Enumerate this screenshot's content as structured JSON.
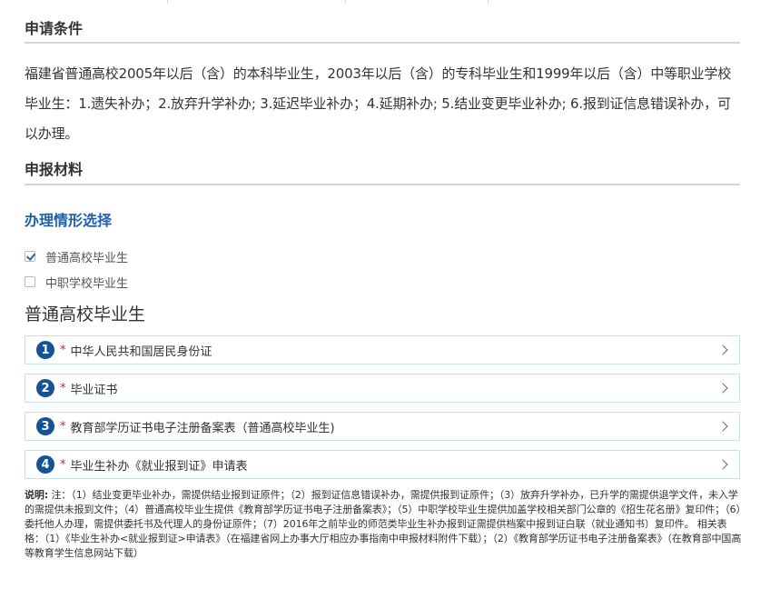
{
  "sections": {
    "conditions_title": "申请条件",
    "conditions_text": "福建省普通高校2005年以后（含）的本科毕业生，2003年以后（含）的专科毕业生和1999年以后（含）中等职业学校毕业生：1.遗失补办；2.放弃升学补办; 3.延迟毕业补办；4.延期补办; 5.结业变更毕业补办; 6.报到证信息错误补办，可以办理。",
    "materials_title": "申报材料"
  },
  "situation": {
    "title": "办理情形选择",
    "options": [
      {
        "label": "普通高校毕业生",
        "checked": true
      },
      {
        "label": "中职学校毕业生",
        "checked": false
      }
    ]
  },
  "materials": {
    "heading": "普通高校毕业生",
    "items": [
      {
        "num": "1",
        "star": "*",
        "label": "中华人民共和国居民身份证"
      },
      {
        "num": "2",
        "star": "*",
        "label": "毕业证书"
      },
      {
        "num": "3",
        "star": "*",
        "label": "教育部学历证书电子注册备案表（普通高校毕业生)"
      },
      {
        "num": "4",
        "star": "*",
        "label": "毕业生补办《就业报到证》申请表"
      }
    ]
  },
  "note": {
    "label": "说明:",
    "text": " 注：（1）结业变更毕业补办，需提供结业报到证原件；（2）报到证信息错误补办，需提供报到证原件；（3）放弃升学补办，已升学的需提供退学文件，未入学的需提供未报到文件；（4）普通高校毕业生提供《教育部学历证书电子注册备案表》；（5）中职学校毕业生提供加盖学校相关部门公章的《招生花名册》复印件；（6）委托他人办理，需提供委托书及代理人的身份证原件；（7）2016年之前毕业的师范类毕业生补办报到证需提供档案中报到证白联（就业通知书）复印件。 相关表格：（1）《毕业生补办<就业报到证>申请表》（在福建省网上办事大厅相应办事指南中申报材料附件下载）；（2）《教育部学历证书电子注册备案表》（在教育部中国高等教育学生信息网站下载）"
  }
}
